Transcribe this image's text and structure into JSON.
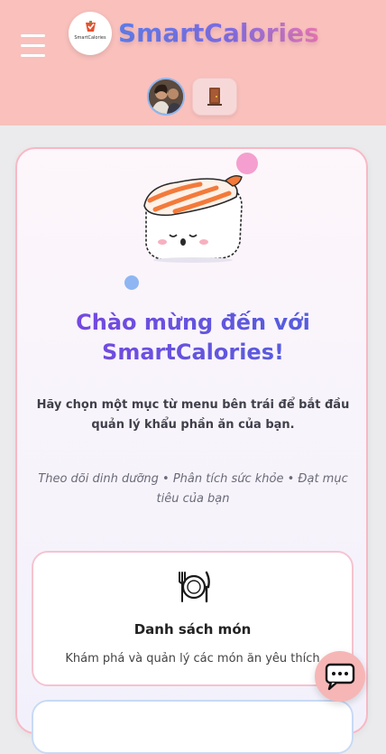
{
  "header": {
    "brand_name": "SmartCalories",
    "logo_text": "SmartCalories",
    "menu_icon": "hamburger-icon",
    "avatar_icon": "user-avatar",
    "logout_icon": "door-icon"
  },
  "welcome": {
    "title_line1": "Chào mừng đến với",
    "title_line2": "SmartCalories!",
    "description": "Hãy chọn một mục từ menu bên trái để bắt đầu quản lý khẩu phần ăn của bạn.",
    "tagline": "Theo dõi dinh dưỡng • Phân tích sức khỏe • Đạt mục tiêu của bạn",
    "illustration": "sushi-mascot"
  },
  "features": [
    {
      "icon": "plate-cutlery-icon",
      "title": "Danh sách món",
      "description": "Khám phá và quản lý các món ăn yêu thích"
    }
  ],
  "chat": {
    "icon": "chat-bubble-icon"
  },
  "colors": {
    "header_bg": "#f9c0bc",
    "brand_gradient_start": "#5b7ff0",
    "brand_gradient_end": "#ee78b4",
    "title_gradient_start": "#7b45e0",
    "title_gradient_end": "#4f62dd",
    "card_border": "#f8b8c4"
  }
}
